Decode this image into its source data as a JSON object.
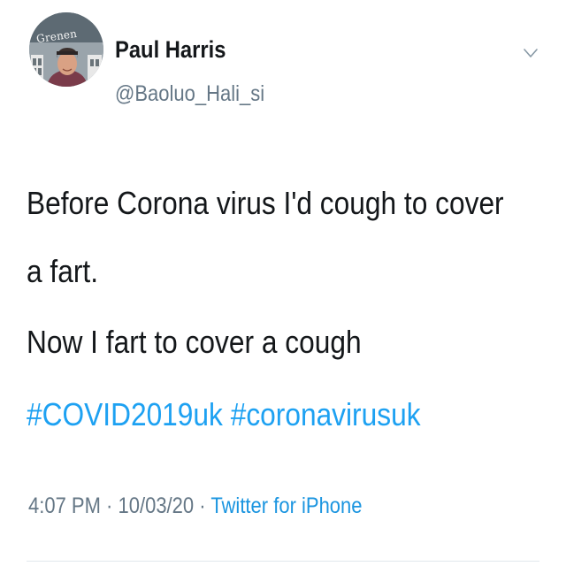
{
  "author": {
    "name": "Paul Harris",
    "handle": "@Baoluo_Hali_si",
    "avatar_logo_text": "Grenen"
  },
  "menu": {
    "icon": "chevron-down-icon"
  },
  "tweet": {
    "lines": [
      "Before Corona virus I'd cough to cover",
      "a fart.",
      "Now I fart to cover a cough"
    ],
    "hashtags": [
      "#COVID2019uk",
      "#coronavirusuk"
    ]
  },
  "meta": {
    "time": "4:07 PM",
    "separator": "·",
    "date": "10/03/20",
    "source": "Twitter for iPhone"
  },
  "colors": {
    "text": "#14171a",
    "secondary": "#657786",
    "link": "#1da1f2"
  }
}
